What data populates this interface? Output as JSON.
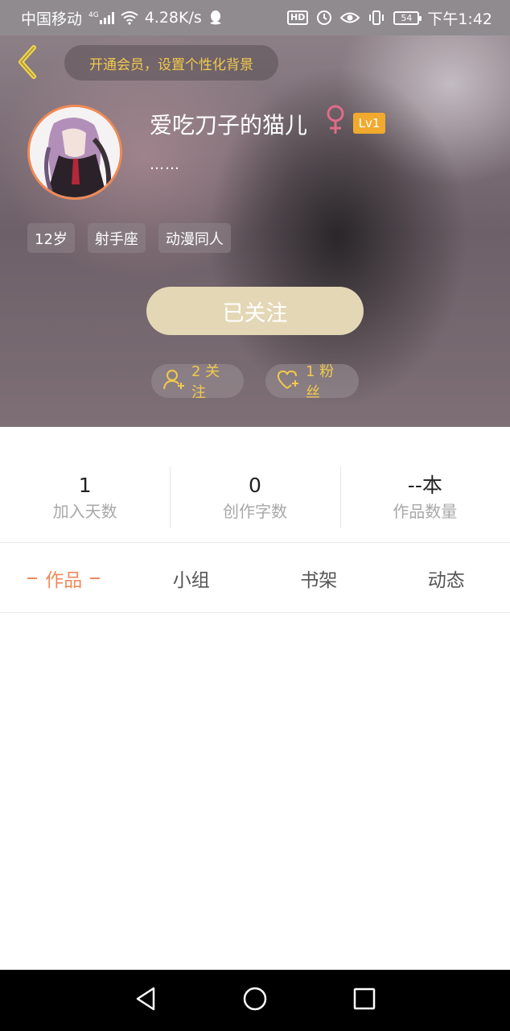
{
  "status_bar": {
    "carrier": "中国移动",
    "network_type": "4G",
    "speed": "4.28K/s",
    "hd_label": "HD",
    "battery": "54",
    "time": "下午1:42"
  },
  "header": {
    "vip_banner": "开通会员，设置个性化背景",
    "username": "爱吃刀子的猫儿",
    "gender": "female",
    "level": "Lv1",
    "bio": "……",
    "tags": [
      "12岁",
      "射手座",
      "动漫同人"
    ],
    "follow_button": "已关注",
    "following_count": "2 关注",
    "fans_count": "1 粉丝"
  },
  "stats": [
    {
      "value": "1",
      "label": "加入天数"
    },
    {
      "value": "0",
      "label": "创作字数"
    },
    {
      "value": "--本",
      "label": "作品数量"
    }
  ],
  "tabs": [
    {
      "label": "作品",
      "active": true
    },
    {
      "label": "小组",
      "active": false
    },
    {
      "label": "书架",
      "active": false
    },
    {
      "label": "动态",
      "active": false
    }
  ],
  "colors": {
    "accent": "#ef8a5b",
    "gold": "#f2c94c",
    "follow_button": "#e3d7b6",
    "level_badge": "#f1a92e",
    "gender_icon": "#e06c8a"
  },
  "icons": {
    "back": "chevron-left-icon",
    "gender": "female-icon",
    "following": "user-add-icon",
    "fans": "heart-plus-icon",
    "nav_back": "triangle-back-icon",
    "nav_home": "circle-home-icon",
    "nav_recents": "square-recents-icon"
  }
}
